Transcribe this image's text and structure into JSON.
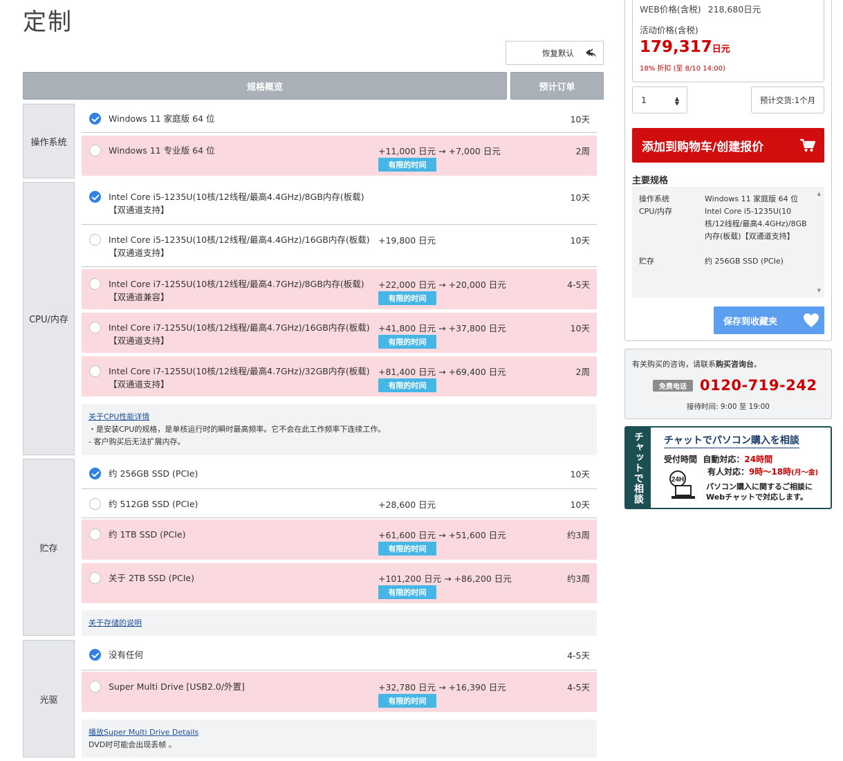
{
  "page": {
    "title": "定制"
  },
  "toolbar": {
    "reset_label": "恢复默认"
  },
  "tabs": {
    "spec": "规格概览",
    "order": "预计订单"
  },
  "categories": {
    "os": "操作系统",
    "cpu": "CPU/内存",
    "storage": "贮存",
    "optical": "光驱"
  },
  "options": {
    "os": [
      {
        "name": "Windows 11 家庭版 64 位",
        "price": "",
        "badge": "",
        "ship": "10天",
        "checked": true
      },
      {
        "name": "Windows 11 专业版 64 位",
        "price": "+11,000 日元 → +7,000 日元",
        "badge": "有限的时间",
        "ship": "2周",
        "checked": false
      }
    ],
    "cpu": [
      {
        "name": "Intel Core i5-1235U(10核/12线程/最高4.4GHz)/8GB内存(板载)【双通道支持】",
        "price": "",
        "badge": "",
        "ship": "10天",
        "checked": true
      },
      {
        "name": "Intel Core i5-1235U(10核/12线程/最高4.4GHz)/16GB内存(板载)【双通道支持】",
        "price": "+19,800 日元",
        "badge": "",
        "ship": "10天",
        "checked": false
      },
      {
        "name": "Intel Core i7-1255U(10核/12线程/最高4.7GHz)/8GB内存(板载)【双通道兼容】",
        "price": "+22,000 日元 → +20,000 日元",
        "badge": "有限的时间",
        "ship": "4-5天",
        "checked": false
      },
      {
        "name": "Intel Core i7-1255U(10核/12线程/最高4.7GHz)/16GB内存(板载)【双通道支持】",
        "price": "+41,800 日元 → +37,800 日元",
        "badge": "有限的时间",
        "ship": "10天",
        "checked": false
      },
      {
        "name": "Intel Core i7-1255U(10核/12线程/最高4.7GHz)/32GB内存(板载)【双通道支持】",
        "price": "+81,400 日元 → +69,400 日元",
        "badge": "有限的时间",
        "ship": "2周",
        "checked": false
      }
    ],
    "storage": [
      {
        "name": "约 256GB SSD (PCIe)",
        "price": "",
        "badge": "",
        "ship": "10天",
        "checked": true
      },
      {
        "name": "约 512GB SSD (PCIe)",
        "price": "+28,600 日元",
        "badge": "",
        "ship": "10天",
        "checked": false
      },
      {
        "name": "约 1TB SSD (PCIe)",
        "price": "+61,600 日元 → +51,600 日元",
        "badge": "有限的时间",
        "ship": "约3周",
        "checked": false
      },
      {
        "name": "关于 2TB SSD (PCIe)",
        "price": "+101,200 日元 → +86,200 日元",
        "badge": "有限的时间",
        "ship": "约3周",
        "checked": false
      }
    ],
    "optical": [
      {
        "name": "没有任何",
        "price": "",
        "badge": "",
        "ship": "4-5天",
        "checked": true
      },
      {
        "name": "Super Multi Drive [USB2.0/外置]",
        "price": "+32,780 日元 → +16,390 日元",
        "badge": "有限的时间",
        "ship": "4-5天",
        "checked": false
      }
    ]
  },
  "notes": {
    "cpu_link": "关于CPU性能详情",
    "cpu_line1": "・是安装CPU的规格，是单核运行时的瞬时最高频率。它不会在此工作频率下连续工作。",
    "cpu_line2": "- 客户购买后无法扩展内存。",
    "storage_link": "关于存储的说明",
    "optical_link": "播放Super Multi Drive Details",
    "optical_line1": "DVD时可能会出现丢帧 。"
  },
  "price_box": {
    "web_label": "WEB价格(含税)",
    "web_value": "218,680日元",
    "campaign_label": "活动价格(含税)",
    "campaign_value": "179,317",
    "campaign_unit": "日元",
    "discount": "18% 折扣 (至 8/10 14:00)"
  },
  "order": {
    "quantity": "1",
    "delivery": "预计交货:1个月",
    "cart_label": "添加到购物车/创建报价"
  },
  "specs": {
    "title": "主要规格",
    "items": [
      {
        "key": "操作系统",
        "value": "Windows 11 家庭版 64 位"
      },
      {
        "key": "CPU/内存",
        "value": "Intel Core i5-1235U(10核/12线程/最高4.4GHz)/8GB内存(板载)【双通道支持】"
      },
      {
        "key": "贮存",
        "value": "约 256GB SSD (PCIe)"
      }
    ]
  },
  "favorites": {
    "label": "保存到收藏夹"
  },
  "contact": {
    "prefix": "有关购买的咨询，请联系",
    "desk": "购买咨询台",
    "suffix": "。",
    "free_label": "免费电话",
    "tel": "0120-719-242",
    "hours": "接待时间: 9:00 至 19:00"
  },
  "chat": {
    "side": "チャットで相談",
    "title": "チャットでパソコン購入を相談",
    "reception_label": "受付時間",
    "auto_label": "自動対応：",
    "auto_hours": "24時間",
    "human_label": "有人対応：",
    "human_hours": "9時〜18時",
    "human_days": "(月〜金)",
    "line1": "パソコン購入に関するご相談に",
    "line2": "Webチャットで対応します。",
    "icon_text": "24H"
  },
  "colors": {
    "accent_red": "#d10d0d",
    "price_red": "#cc0000",
    "badge_blue": "#45b6e6",
    "sale_pink": "#fadadf",
    "check_blue": "#2f80e2",
    "fav_blue": "#5c9ef0",
    "chat_green": "#1b4f52"
  }
}
